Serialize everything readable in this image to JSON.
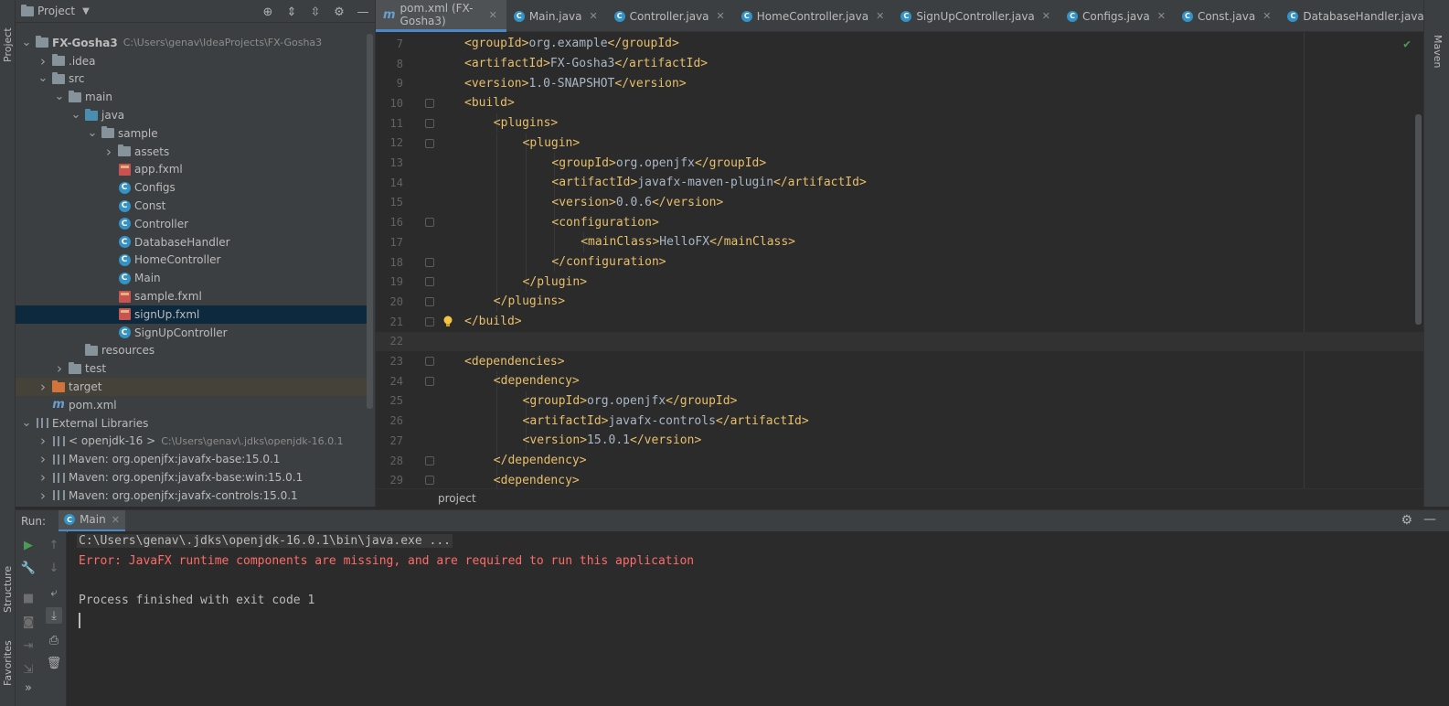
{
  "left_strip": {
    "project_tab": "Project",
    "structure_tab": "Structure",
    "favorites_tab": "Favorites"
  },
  "project_panel": {
    "title": "Project",
    "tree": [
      {
        "label": "FX-Gosha3",
        "hint": "C:\\Users\\genav\\IdeaProjects\\FX-Gosha3",
        "depth": 0,
        "arrow": "down",
        "icon": "module-folder-icon",
        "bold": true
      },
      {
        "label": ".idea",
        "depth": 1,
        "arrow": "right",
        "icon": "folder-icon"
      },
      {
        "label": "src",
        "depth": 1,
        "arrow": "down",
        "icon": "folder-icon"
      },
      {
        "label": "main",
        "depth": 2,
        "arrow": "down",
        "icon": "folder-icon"
      },
      {
        "label": "java",
        "depth": 3,
        "arrow": "down",
        "icon": "source-folder-icon"
      },
      {
        "label": "sample",
        "depth": 4,
        "arrow": "down",
        "icon": "package-icon"
      },
      {
        "label": "assets",
        "depth": 5,
        "arrow": "right",
        "icon": "package-icon"
      },
      {
        "label": "app.fxml",
        "depth": 5,
        "arrow": "",
        "icon": "fxml-file-icon"
      },
      {
        "label": "Configs",
        "depth": 5,
        "arrow": "",
        "icon": "java-class-icon"
      },
      {
        "label": "Const",
        "depth": 5,
        "arrow": "",
        "icon": "java-class-icon"
      },
      {
        "label": "Controller",
        "depth": 5,
        "arrow": "",
        "icon": "java-class-icon"
      },
      {
        "label": "DatabaseHandler",
        "depth": 5,
        "arrow": "",
        "icon": "java-class-icon"
      },
      {
        "label": "HomeController",
        "depth": 5,
        "arrow": "",
        "icon": "java-class-icon"
      },
      {
        "label": "Main",
        "depth": 5,
        "arrow": "",
        "icon": "java-main-class-icon"
      },
      {
        "label": "sample.fxml",
        "depth": 5,
        "arrow": "",
        "icon": "fxml-file-icon"
      },
      {
        "label": "signUp.fxml",
        "depth": 5,
        "arrow": "",
        "icon": "fxml-file-icon",
        "selected": true
      },
      {
        "label": "SignUpController",
        "depth": 5,
        "arrow": "",
        "icon": "java-class-icon"
      },
      {
        "label": "resources",
        "depth": 3,
        "arrow": "",
        "icon": "resources-folder-icon"
      },
      {
        "label": "test",
        "depth": 2,
        "arrow": "right",
        "icon": "folder-icon"
      },
      {
        "label": "target",
        "depth": 1,
        "arrow": "right",
        "icon": "excluded-folder-icon",
        "highlight": true
      },
      {
        "label": "pom.xml",
        "depth": 1,
        "arrow": "",
        "icon": "maven-file-icon"
      },
      {
        "label": "External Libraries",
        "depth": 0,
        "arrow": "down",
        "icon": "libraries-icon"
      },
      {
        "label": "< openjdk-16 >",
        "hint": "C:\\Users\\genav\\.jdks\\openjdk-16.0.1",
        "depth": 1,
        "arrow": "right",
        "icon": "jdk-icon"
      },
      {
        "label": "Maven: org.openjfx:javafx-base:15.0.1",
        "depth": 1,
        "arrow": "right",
        "icon": "library-icon"
      },
      {
        "label": "Maven: org.openjfx:javafx-base:win:15.0.1",
        "depth": 1,
        "arrow": "right",
        "icon": "library-icon"
      },
      {
        "label": "Maven: org.openjfx:javafx-controls:15.0.1",
        "depth": 1,
        "arrow": "right",
        "icon": "library-icon"
      }
    ]
  },
  "tabs": [
    {
      "label": "pom.xml (FX-Gosha3)",
      "icon": "maven-file-icon",
      "active": true
    },
    {
      "label": "Main.java",
      "icon": "java-main-class-icon"
    },
    {
      "label": "Controller.java",
      "icon": "java-class-icon"
    },
    {
      "label": "HomeController.java",
      "icon": "java-class-icon"
    },
    {
      "label": "SignUpController.java",
      "icon": "java-class-icon"
    },
    {
      "label": "Configs.java",
      "icon": "java-class-icon"
    },
    {
      "label": "Const.java",
      "icon": "java-class-icon"
    },
    {
      "label": "DatabaseHandler.java",
      "icon": "java-class-icon"
    }
  ],
  "editor": {
    "lines": [
      {
        "num": "7",
        "indent": 1,
        "open": "<groupId>",
        "text": "org.example",
        "close": "</groupId>"
      },
      {
        "num": "8",
        "indent": 1,
        "open": "<artifactId>",
        "text": "FX-Gosha3",
        "close": "</artifactId>"
      },
      {
        "num": "9",
        "indent": 1,
        "open": "<version>",
        "text": "1.0-SNAPSHOT",
        "close": "</version>"
      },
      {
        "num": "10",
        "indent": 1,
        "open": "<build>",
        "text": "",
        "close": "",
        "fold": true
      },
      {
        "num": "11",
        "indent": 2,
        "open": "<plugins>",
        "text": "",
        "close": "",
        "fold": true
      },
      {
        "num": "12",
        "indent": 3,
        "open": "<plugin>",
        "text": "",
        "close": "",
        "fold": true
      },
      {
        "num": "13",
        "indent": 4,
        "open": "<groupId>",
        "text": "org.openjfx",
        "close": "</groupId>"
      },
      {
        "num": "14",
        "indent": 4,
        "open": "<artifactId>",
        "text": "javafx-maven-plugin",
        "close": "</artifactId>"
      },
      {
        "num": "15",
        "indent": 4,
        "open": "<version>",
        "text": "0.0.6",
        "close": "</version>"
      },
      {
        "num": "16",
        "indent": 4,
        "open": "<configuration>",
        "text": "",
        "close": "",
        "fold": true
      },
      {
        "num": "17",
        "indent": 5,
        "open": "<mainClass>",
        "text": "HelloFX",
        "close": "</mainClass>"
      },
      {
        "num": "18",
        "indent": 4,
        "open": "</configuration>",
        "text": "",
        "close": "",
        "fold": true
      },
      {
        "num": "19",
        "indent": 3,
        "open": "</plugin>",
        "text": "",
        "close": "",
        "fold": true
      },
      {
        "num": "20",
        "indent": 2,
        "open": "</plugins>",
        "text": "",
        "close": "",
        "fold": true
      },
      {
        "num": "21",
        "indent": 1,
        "open": "</build>",
        "text": "",
        "close": "",
        "fold": true,
        "bulb": true
      },
      {
        "num": "22",
        "indent": 0,
        "open": "",
        "text": "",
        "close": "",
        "current": true
      },
      {
        "num": "23",
        "indent": 1,
        "open": "<dependencies>",
        "text": "",
        "close": "",
        "fold": true
      },
      {
        "num": "24",
        "indent": 2,
        "open": "<dependency>",
        "text": "",
        "close": "",
        "fold": true
      },
      {
        "num": "25",
        "indent": 3,
        "open": "<groupId>",
        "text": "org.openjfx",
        "close": "</groupId>"
      },
      {
        "num": "26",
        "indent": 3,
        "open": "<artifactId>",
        "text": "javafx-controls",
        "close": "</artifactId>"
      },
      {
        "num": "27",
        "indent": 3,
        "open": "<version>",
        "text": "15.0.1",
        "close": "</version>"
      },
      {
        "num": "28",
        "indent": 2,
        "open": "</dependency>",
        "text": "",
        "close": "",
        "fold": true
      },
      {
        "num": "29",
        "indent": 2,
        "open": "<dependency>",
        "text": "",
        "close": "",
        "fold": true
      }
    ],
    "breadcrumb": "project",
    "maven_tab": "Maven"
  },
  "run": {
    "label": "Run:",
    "tab": "Main",
    "console": {
      "command": "C:\\Users\\genav\\.jdks\\openjdk-16.0.1\\bin\\java.exe ...",
      "error": "Error: JavaFX runtime components are missing, and are required to run this application",
      "finished": "Process finished with exit code 1"
    }
  },
  "colors": {
    "tag": "#e8bf6a",
    "text": "#a9b7c6",
    "error": "#ff6b68",
    "accent": "#4a88c7",
    "selection": "#0d293e"
  }
}
